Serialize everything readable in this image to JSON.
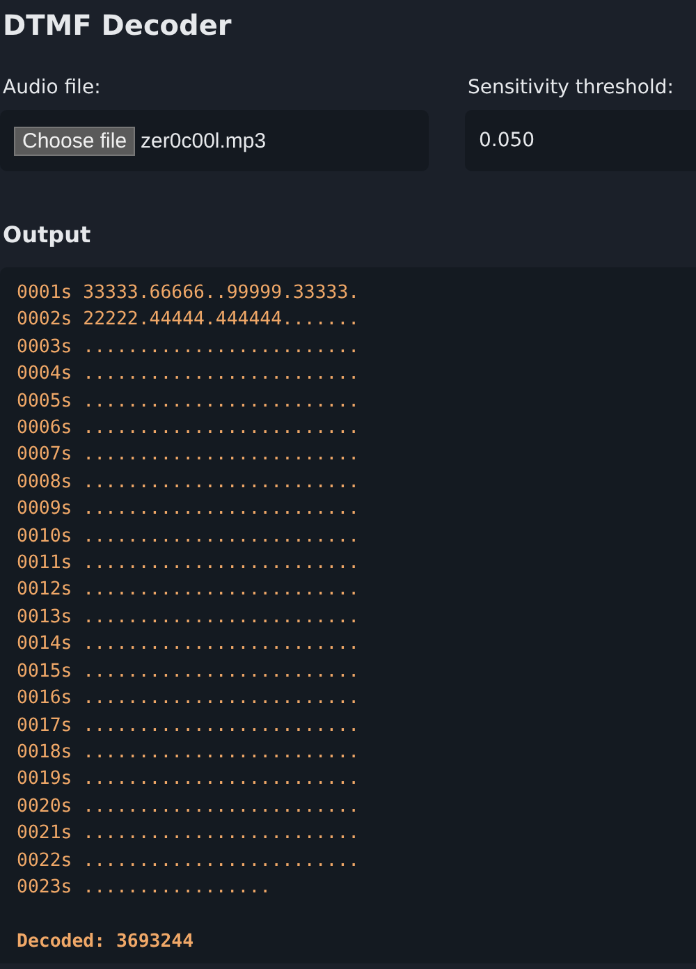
{
  "title": "DTMF Decoder",
  "audio_file": {
    "label": "Audio file:",
    "button": "Choose file",
    "file_name": "zer0c00l.mp3"
  },
  "threshold": {
    "label": "Sensitivity threshold:",
    "value": "0.050"
  },
  "output": {
    "heading": "Output",
    "lines": [
      "0001s 33333.66666..99999.33333.",
      "0002s 22222.44444.444444.......",
      "0003s .........................",
      "0004s .........................",
      "0005s .........................",
      "0006s .........................",
      "0007s .........................",
      "0008s .........................",
      "0009s .........................",
      "0010s .........................",
      "0011s .........................",
      "0012s .........................",
      "0013s .........................",
      "0014s .........................",
      "0015s .........................",
      "0016s .........................",
      "0017s .........................",
      "0018s .........................",
      "0019s .........................",
      "0020s .........................",
      "0021s .........................",
      "0022s .........................",
      "0023s ................."
    ],
    "decoded": "Decoded: 3693244"
  }
}
